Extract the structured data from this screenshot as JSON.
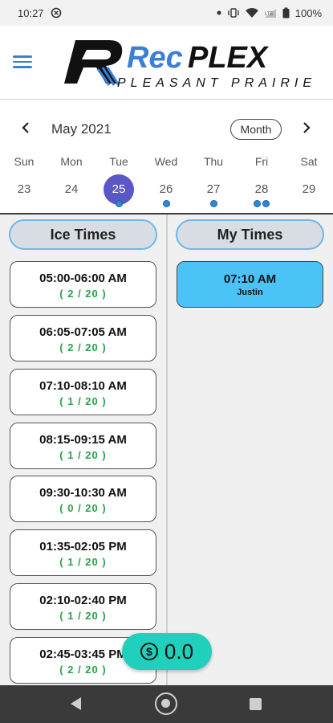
{
  "status_bar": {
    "time": "10:27",
    "network": "LTE",
    "battery": "100%",
    "icons": [
      "sync-icon",
      "dot-icon",
      "vibrate-icon",
      "wifi-icon",
      "signal-icon",
      "battery-icon"
    ]
  },
  "header": {
    "menu_icon": "hamburger-menu-icon",
    "logo": {
      "line1_a": "Rec",
      "line1_b": "PLEX",
      "line2": "PLEASANT PRAIRIE",
      "colors": {
        "accent": "#3b7fd6",
        "dark": "#111111"
      }
    }
  },
  "calendar": {
    "month_label": "May 2021",
    "mode_button": "Month",
    "prev_icon": "chevron-left-icon",
    "next_icon": "chevron-right-icon",
    "weekdays": [
      "Sun",
      "Mon",
      "Tue",
      "Wed",
      "Thu",
      "Fri",
      "Sat"
    ],
    "days": [
      {
        "num": "23",
        "dots": 0,
        "selected": false
      },
      {
        "num": "24",
        "dots": 0,
        "selected": false
      },
      {
        "num": "25",
        "dots": 1,
        "selected": true
      },
      {
        "num": "26",
        "dots": 1,
        "selected": false
      },
      {
        "num": "27",
        "dots": 1,
        "selected": false
      },
      {
        "num": "28",
        "dots": 2,
        "selected": false
      },
      {
        "num": "29",
        "dots": 0,
        "selected": false
      }
    ],
    "selected_color": "#5b57c6",
    "dot_color": "#2f87d8"
  },
  "ice_times": {
    "title": "Ice Times",
    "slots": [
      {
        "time": "05:00-06:00 AM",
        "count": "( 2 / 20 )"
      },
      {
        "time": "06:05-07:05 AM",
        "count": "( 2 / 20 )"
      },
      {
        "time": "07:10-08:10 AM",
        "count": "( 1 / 20 )"
      },
      {
        "time": "08:15-09:15 AM",
        "count": "( 1 / 20 )"
      },
      {
        "time": "09:30-10:30 AM",
        "count": "( 0 / 20 )"
      },
      {
        "time": "01:35-02:05 PM",
        "count": "( 1 / 20 )"
      },
      {
        "time": "02:10-02:40 PM",
        "count": "( 1 / 20 )"
      },
      {
        "time": "02:45-03:45 PM",
        "count": "( 2 / 20 )"
      }
    ],
    "count_color": "#2aa24a"
  },
  "my_times": {
    "title": "My Times",
    "slots": [
      {
        "time": "07:10 AM",
        "name": "Justin"
      }
    ],
    "slot_color": "#4bc3f7"
  },
  "balance": {
    "icon": "dollar-coin-icon",
    "value": "0.0",
    "color": "#20d0bd"
  },
  "nav_bar": {
    "icons": [
      "back-icon",
      "home-icon",
      "recents-icon"
    ]
  }
}
